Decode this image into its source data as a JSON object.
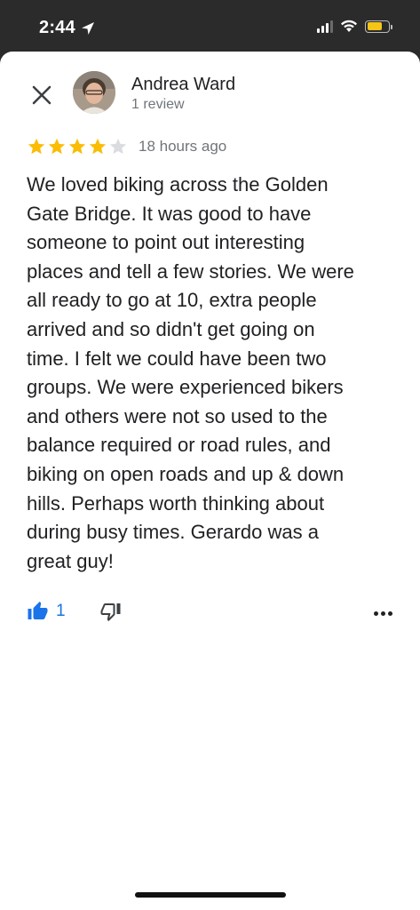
{
  "status_bar": {
    "time": "2:44",
    "battery_color": "#f5c518"
  },
  "review": {
    "author_name": "Andrea Ward",
    "author_meta": "1 review",
    "rating": 4,
    "rating_max": 5,
    "star_color": "#fbbc04",
    "time_ago": "18 hours ago",
    "text": "We loved biking across the Golden\nGate Bridge. It was good to have\nsomeone to point out interesting\nplaces and tell a few stories.  We were\nall ready to go at 10, extra people\narrived and so didn't get going on\ntime.  I felt we could have been two\ngroups.  We were experienced bikers\nand others were not so used to the\nbalance required or road rules, and\nbiking on open roads and up & down\nhills.  Perhaps worth thinking about\nduring busy times. Gerardo was a\ngreat guy!"
  },
  "actions": {
    "like_count": "1",
    "accent": "#1a73e8",
    "icons": [
      "thumbs-up-icon",
      "thumbs-down-icon",
      "more-icon",
      "close-icon"
    ]
  }
}
